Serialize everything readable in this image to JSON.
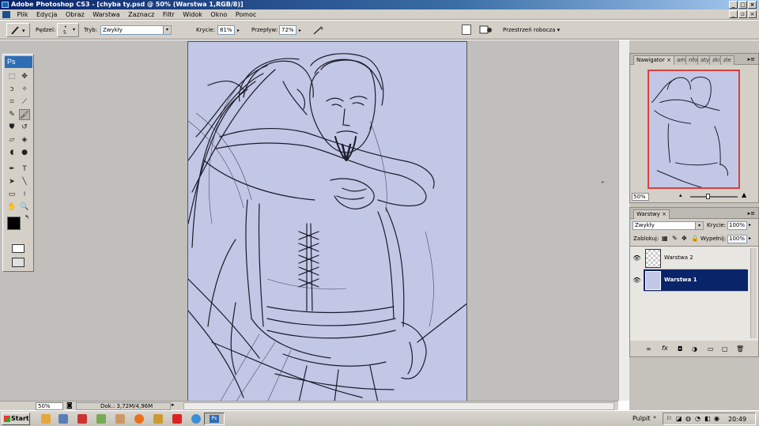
{
  "window": {
    "title": "Adobe Photoshop CS3 - [chyba ty.psd @ 50% (Warstwa 1,RGB/8)]"
  },
  "menu": [
    "Plik",
    "Edycja",
    "Obraz",
    "Warstwa",
    "Zaznacz",
    "Filtr",
    "Widok",
    "Okno",
    "Pomoc"
  ],
  "options": {
    "brush_label": "Pędzel:",
    "brush_size": "5",
    "mode_label": "Tryb:",
    "mode_value": "Zwykły",
    "opacity_label": "Krycie:",
    "opacity_value": "81%",
    "flow_label": "Przepływ:",
    "flow_value": "72%",
    "workspace_label": "Przestrzeń robocza"
  },
  "navigator": {
    "tabs": [
      "Nawigator",
      "am",
      "nfo",
      "aty",
      "zki",
      "zle"
    ],
    "zoom": "50%"
  },
  "layers_panel": {
    "tab": "Warstwy",
    "blend_mode": "Zwykły",
    "opacity_label": "Krycie:",
    "opacity_value": "100%",
    "lock_label": "Zablokuj:",
    "fill_label": "Wypełnij:",
    "fill_value": "100%",
    "layers": [
      {
        "name": "Warstwa 2",
        "selected": false
      },
      {
        "name": "Warstwa 1",
        "selected": true
      }
    ]
  },
  "status": {
    "zoom": "50%",
    "doc": "Dok.: 3,72M/4,96M"
  },
  "taskbar": {
    "start": "Start",
    "desktop_label": "Pulpit",
    "clock": "20:49"
  },
  "colors": {
    "canvas_bg": "#c3c7e6",
    "selected_layer": "#0a246a"
  }
}
